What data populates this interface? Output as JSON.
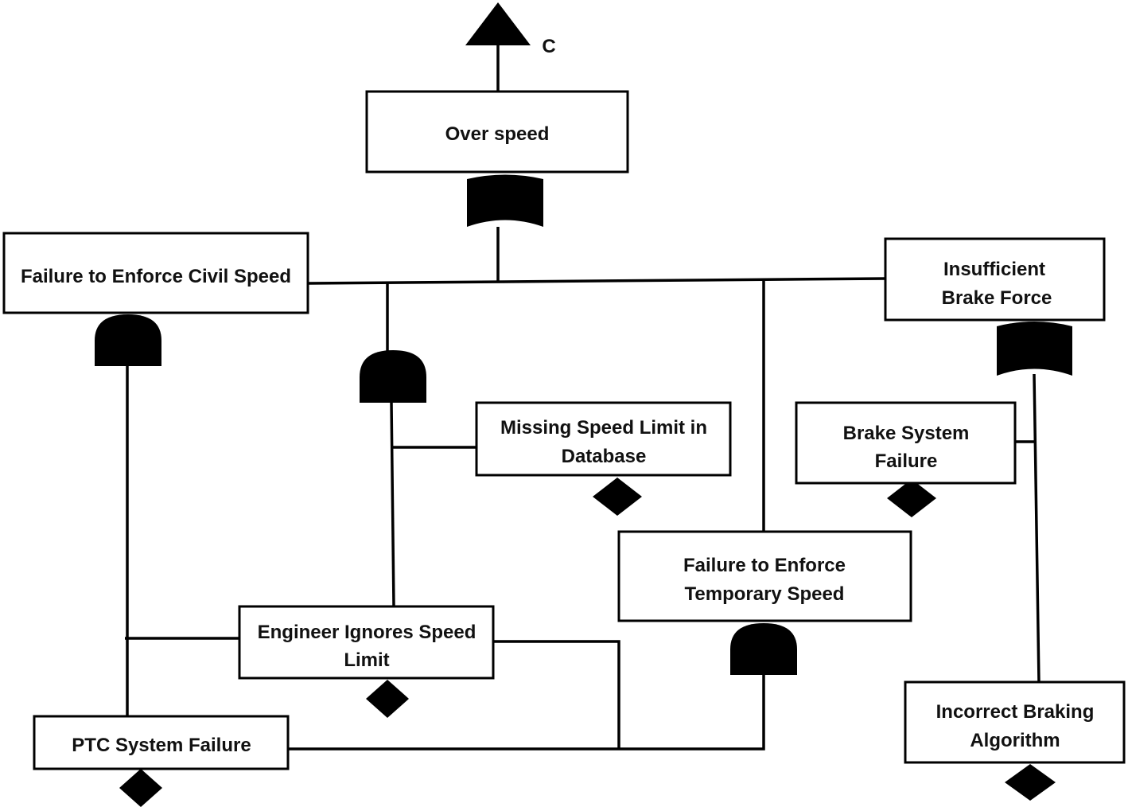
{
  "diagram": {
    "transfer_label": "C",
    "events": {
      "top": {
        "lines": [
          "Over speed"
        ]
      },
      "civil": {
        "lines": [
          "Failure to Enforce Civil Speed"
        ]
      },
      "brake_force": {
        "lines": [
          "Insufficient",
          "Brake Force"
        ]
      },
      "missing_limit": {
        "lines": [
          "Missing Speed Limit in",
          "Database"
        ]
      },
      "brake_system": {
        "lines": [
          "Brake System",
          "Failure"
        ]
      },
      "temporary": {
        "lines": [
          "Failure to Enforce",
          "Temporary Speed"
        ]
      },
      "engineer": {
        "lines": [
          "Engineer Ignores Speed",
          "Limit"
        ]
      },
      "ptc": {
        "lines": [
          "PTC System Failure"
        ]
      },
      "algorithm": {
        "lines": [
          "Incorrect Braking",
          "Algorithm"
        ]
      }
    },
    "gates": {
      "top": "or-gate",
      "civil": "and-gate",
      "sub": "and-gate",
      "brake_force": "or-gate",
      "temporary": "and-gate"
    }
  }
}
